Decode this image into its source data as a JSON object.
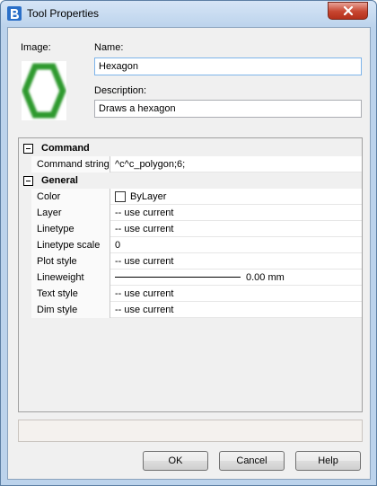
{
  "window": {
    "title": "Tool Properties",
    "close_glyph": "✕"
  },
  "tool": {
    "image_label": "Image:",
    "name_label": "Name:",
    "name_value": "Hexagon",
    "description_label": "Description:",
    "description_value": "Draws a hexagon",
    "preview_icon": "hexagon-icon",
    "preview_color": "#2e9a2e"
  },
  "properties": {
    "command_category": "Command",
    "command_rows": [
      {
        "name": "Command string",
        "value": "^c^c_polygon;6;"
      }
    ],
    "general_category": "General",
    "general_rows": [
      {
        "name": "Color",
        "value": "ByLayer"
      },
      {
        "name": "Layer",
        "value": "-- use current"
      },
      {
        "name": "Linetype",
        "value": "-- use current"
      },
      {
        "name": "Linetype scale",
        "value": "0"
      },
      {
        "name": "Plot style",
        "value": "-- use current"
      },
      {
        "name": "Lineweight",
        "value": "0.00 mm"
      },
      {
        "name": "Text style",
        "value": "-- use current"
      },
      {
        "name": "Dim style",
        "value": "-- use current"
      }
    ]
  },
  "buttons": {
    "ok": "OK",
    "cancel": "Cancel",
    "help": "Help"
  }
}
